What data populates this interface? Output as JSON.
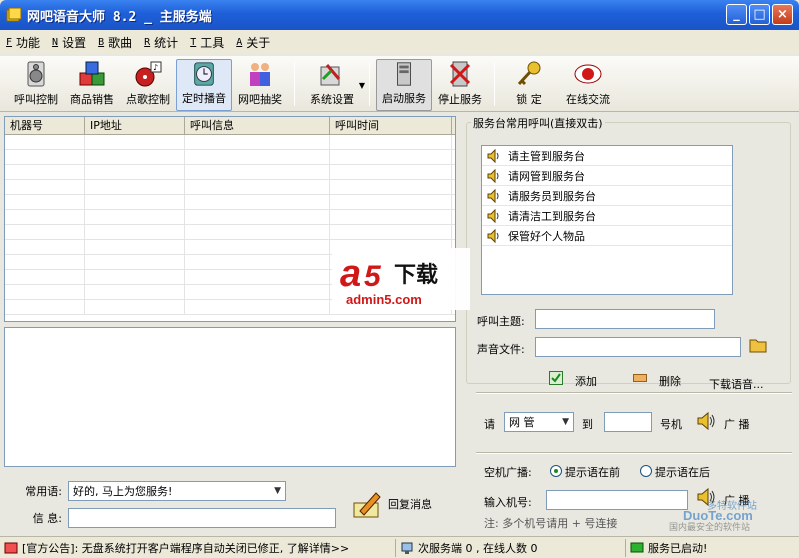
{
  "titlebar": {
    "title": "网吧语音大师 8.2 _ 主服务端"
  },
  "menu": [
    {
      "key": "F",
      "label": "功能"
    },
    {
      "key": "N",
      "label": "设置"
    },
    {
      "key": "B",
      "label": "歌曲"
    },
    {
      "key": "R",
      "label": "统计"
    },
    {
      "key": "T",
      "label": "工具"
    },
    {
      "key": "A",
      "label": "关于"
    }
  ],
  "toolbar": {
    "call_control": "呼叫控制",
    "goods_sale": "商品销售",
    "song_control": "点歌控制",
    "timed_play": "定时播音",
    "lottery": "网吧抽奖",
    "settings": "系统设置",
    "start_service": "启动服务",
    "stop_service": "停止服务",
    "lock": "锁 定",
    "online_chat": "在线交流"
  },
  "table": {
    "columns": [
      "机器号",
      "IP地址",
      "呼叫信息",
      "呼叫时间"
    ]
  },
  "bottom": {
    "common_label": "常用语:",
    "common_value": "好的, 马上为您服务!",
    "info_label": "信 息:",
    "reply_label": "回复消息"
  },
  "calls": {
    "group_title": "服务台常用呼叫(直接双击)",
    "items": [
      "请主管到服务台",
      "请网管到服务台",
      "请服务员到服务台",
      "请清洁工到服务台",
      "保管好个人物品"
    ]
  },
  "form": {
    "subject_label": "呼叫主题:",
    "sound_label": "声音文件:",
    "add_label": "添加",
    "delete_label": "删除",
    "download_label": "下载语音...",
    "please_label": "请",
    "staff_select": "网 管",
    "to_label": "到",
    "number_label": "号机",
    "broadcast_label": "广 播",
    "empty_broadcast_label": "空机广播:",
    "tone_before": "提示语在前",
    "tone_after": "提示语在后",
    "input_machine_label": "输入机号:",
    "note_label": "注: 多个机号请用 + 号连接"
  },
  "watermark": {
    "brand_a": "a",
    "brand_5": "5",
    "brand_cn": "下载",
    "site": "admin5.com"
  },
  "duote": {
    "site": "DuoTe.com",
    "tagline": "国内最安全的软件站",
    "cn": "多特软件站"
  },
  "status": {
    "notice": "[官方公告]: 无盘系统打开客户端程序自动关闭已修正, 了解详情>>",
    "service_count": "次服务端 0 , 在线人数 0",
    "service_state": "服务已启动!"
  },
  "colors": {
    "title_blue": "#1e5fd8",
    "brand_red": "#d01818",
    "accent_green": "#1a8a1a"
  }
}
